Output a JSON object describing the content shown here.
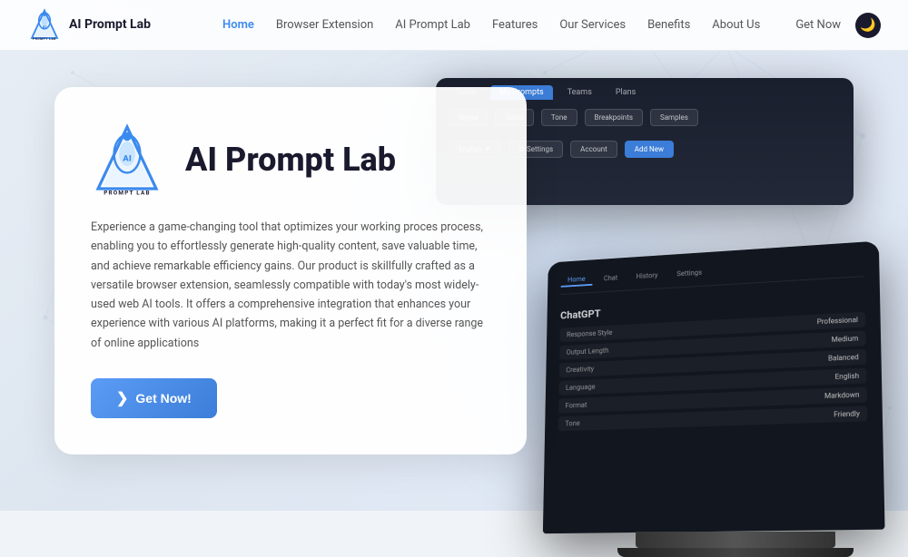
{
  "brand": {
    "name": "AI Prompt Lab",
    "logo_text": "PROMPT LAB",
    "logo_sub": "AI"
  },
  "nav": {
    "links": [
      {
        "label": "Home",
        "active": true
      },
      {
        "label": "Browser Extension",
        "active": false
      },
      {
        "label": "AI Prompt Lab",
        "active": false
      },
      {
        "label": "Features",
        "active": false
      },
      {
        "label": "Our Services",
        "active": false
      },
      {
        "label": "Benefits",
        "active": false
      },
      {
        "label": "About Us",
        "active": false
      }
    ],
    "get_now": "Get Now",
    "dark_mode_icon": "🌙"
  },
  "hero": {
    "title": "AI Prompt Lab",
    "description": "Experience a game-changing tool that optimizes your working proces process, enabling you to effortlessly generate high-quality content, save valuable time, and achieve remarkable efficiency gains. Our product is skillfully crafted as a versatile browser extension, seamlessly compatible with today's most widely-used web AI tools. It offers a comprehensive integration that enhances your experience with various AI platforms, making it a perfect fit for a diverse range of online applications",
    "cta_label": "Get Now!",
    "cta_icon": "❯"
  },
  "mockup_top": {
    "tabs": [
      "Tools",
      "My Prompts",
      "Teams",
      "Plans"
    ],
    "active_tab": "My Prompts",
    "buttons": [
      "Styles",
      "Goals",
      "Tone",
      "Breakpoints",
      "Samples"
    ],
    "right_buttons": [
      "English ▼",
      "Settings",
      "Account"
    ],
    "add_new": "Add New"
  },
  "mockup_tablet": {
    "app_name": "ChatGPT",
    "tabs": [
      "Home",
      "Chat",
      "History",
      "Settings"
    ],
    "rows": [
      {
        "label": "Response Style",
        "value": "Professional"
      },
      {
        "label": "Output Length",
        "value": "Medium"
      },
      {
        "label": "Creativity",
        "value": "Balanced"
      },
      {
        "label": "Language",
        "value": "English"
      },
      {
        "label": "Format",
        "value": "Markdown"
      },
      {
        "label": "Tone",
        "value": "Friendly"
      }
    ]
  },
  "colors": {
    "accent": "#3b8aee",
    "dark": "#1a1a2e",
    "card_bg": "rgba(255,255,255,0.95)"
  }
}
